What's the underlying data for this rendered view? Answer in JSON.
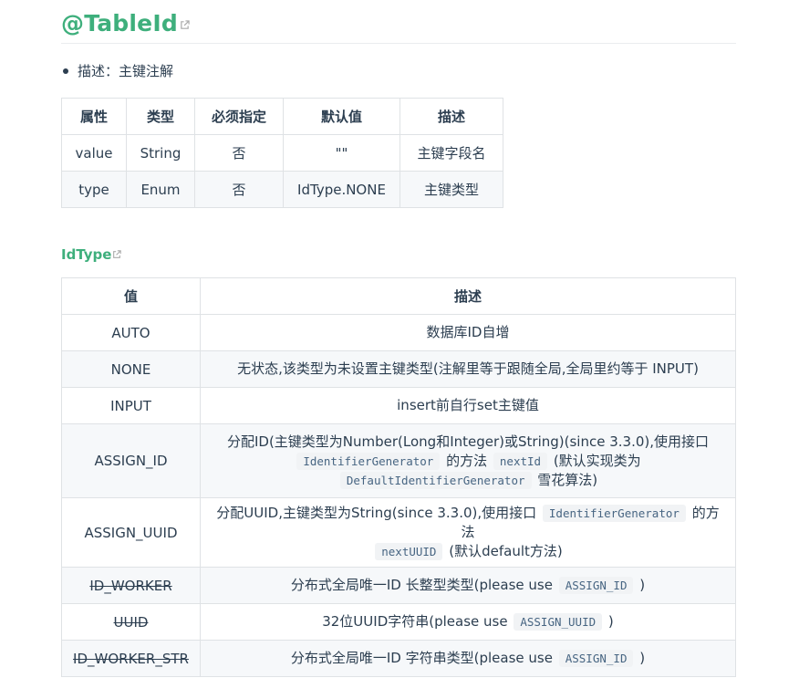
{
  "heading": {
    "title": "@TableId"
  },
  "bullet": {
    "text": "描述：主键注解"
  },
  "attr_table": {
    "headers": [
      "属性",
      "类型",
      "必须指定",
      "默认值",
      "描述"
    ],
    "rows": [
      [
        "value",
        "String",
        "否",
        "\"\"",
        "主键字段名"
      ],
      [
        "type",
        "Enum",
        "否",
        "IdType.NONE",
        "主键类型"
      ]
    ]
  },
  "idtype": {
    "title": "IdType",
    "headers": [
      "值",
      "描述"
    ],
    "rows": [
      {
        "value": "AUTO",
        "desc": "数据库ID自增"
      },
      {
        "value": "NONE",
        "desc": "无状态,该类型为未设置主键类型(注解里等于跟随全局,全局里约等于 INPUT)"
      },
      {
        "value": "INPUT",
        "desc": "insert前自行set主键值"
      },
      {
        "value": "ASSIGN_ID",
        "desc_a": "分配ID(主键类型为Number(Long和Integer)或String)(since 3.3.0),使用接口",
        "code_a": "IdentifierGenerator",
        "desc_b": "的方法",
        "code_b": "nextId",
        "desc_c": "(默认实现类为",
        "code_c": "DefaultIdentifierGenerator",
        "desc_d": "雪花算法)"
      },
      {
        "value": "ASSIGN_UUID",
        "desc_a": "分配UUID,主键类型为String(since 3.3.0),使用接口",
        "code_a": "IdentifierGenerator",
        "desc_b": "的方法",
        "code_b": "nextUUID",
        "desc_c": "(默认default方法)"
      },
      {
        "value": "ID_WORKER",
        "desc_a": "分布式全局唯一ID 长整型类型(please use",
        "code_a": "ASSIGN_ID",
        "desc_b": ")"
      },
      {
        "value": "UUID",
        "desc_a": "32位UUID字符串(please use",
        "code_a": "ASSIGN_UUID",
        "desc_b": ")"
      },
      {
        "value": "ID_WORKER_STR",
        "desc_a": "分布式全局唯一ID 字符串类型(please use",
        "code_a": "ASSIGN_ID",
        "desc_b": ")"
      }
    ]
  },
  "icons": {
    "external_link": "external-link-icon"
  },
  "colors": {
    "accent": "#3eaf7c",
    "text": "#2c3e50",
    "border": "#dfe2e5",
    "row_alt": "#f6f8fa",
    "code_bg": "#f1f3f5"
  }
}
